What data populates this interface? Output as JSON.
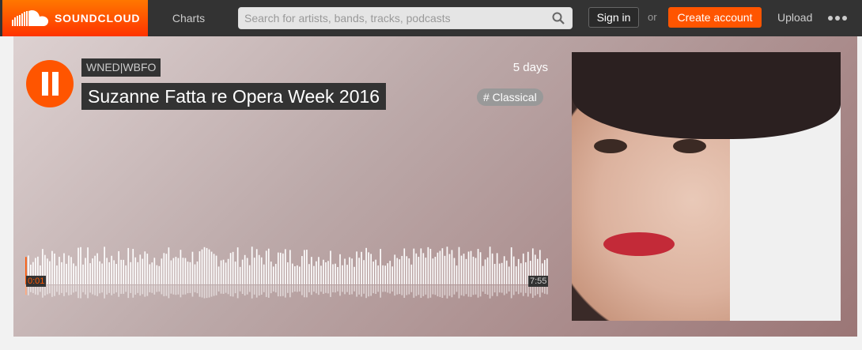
{
  "header": {
    "logo_text": "SOUNDCLOUD",
    "nav_charts": "Charts",
    "search_placeholder": "Search for artists, bands, tracks, podcasts",
    "sign_in": "Sign in",
    "or": "or",
    "create_account": "Create account",
    "upload": "Upload",
    "more_icon": "ellipsis-icon",
    "accent": "#ff5500"
  },
  "track": {
    "artist": "WNED|WBFO",
    "title": "Suzanne Fatta re Opera Week 2016",
    "age": "5 days",
    "tag": "# Classical",
    "current_time": "0:01",
    "duration": "7:55",
    "progress": 0.002,
    "play_state_icon": "pause-icon"
  }
}
